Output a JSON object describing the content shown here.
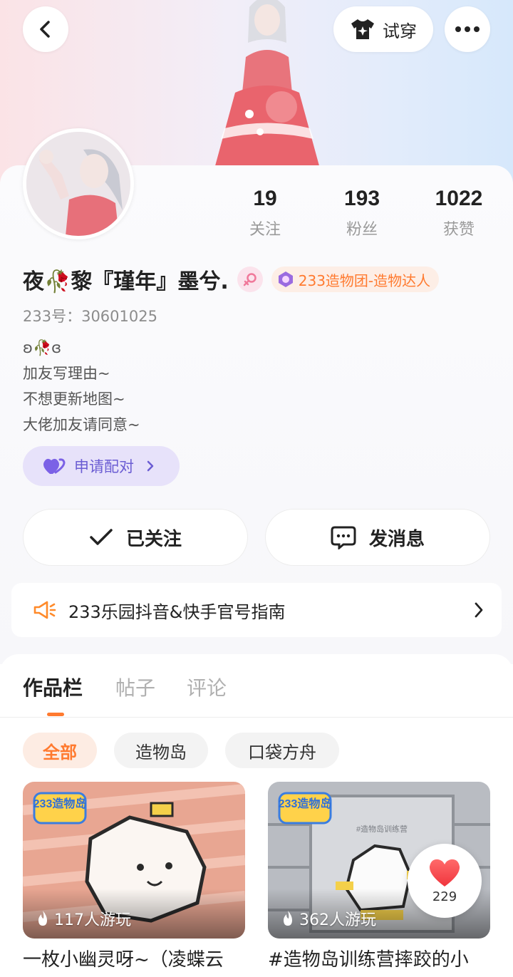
{
  "header": {
    "tryon_label": "试穿",
    "back_icon": "back-chevron-icon",
    "more_icon": "more-dots-icon"
  },
  "profile": {
    "name": "夜🥀黎『瑾年』墨兮.",
    "title_badge": "233造物团-造物达人",
    "id_line": "233号：30601025",
    "bio": [
      "ʚ🥀ɞ",
      "加友写理由~",
      "不想更新地图~",
      "大佬加友请同意~"
    ],
    "pair_button": "申请配对"
  },
  "stats": [
    {
      "value": "19",
      "label": "关注"
    },
    {
      "value": "193",
      "label": "粉丝"
    },
    {
      "value": "1022",
      "label": "获赞"
    }
  ],
  "actions": {
    "followed": "已关注",
    "message": "发消息"
  },
  "notice": {
    "text": "233乐园抖音&快手官号指南"
  },
  "tabs": [
    "作品栏",
    "帖子",
    "评论"
  ],
  "filters": [
    "全部",
    "造物岛",
    "口袋方舟"
  ],
  "works": [
    {
      "plays": "117人游玩",
      "title": "一枚小幽灵呀~（凌蝶云",
      "logo_text": "233造物岛"
    },
    {
      "plays": "362人游玩",
      "title": "#造物岛训练营摔跤的小",
      "logo_text": "233造物岛",
      "sign_text": "#造物岛训练营"
    }
  ],
  "like_bubble": {
    "count": "229"
  },
  "colors": {
    "accent": "#ff7a2f",
    "pair_purple": "#6b5dd3",
    "stat_label": "#9a9a9a"
  }
}
